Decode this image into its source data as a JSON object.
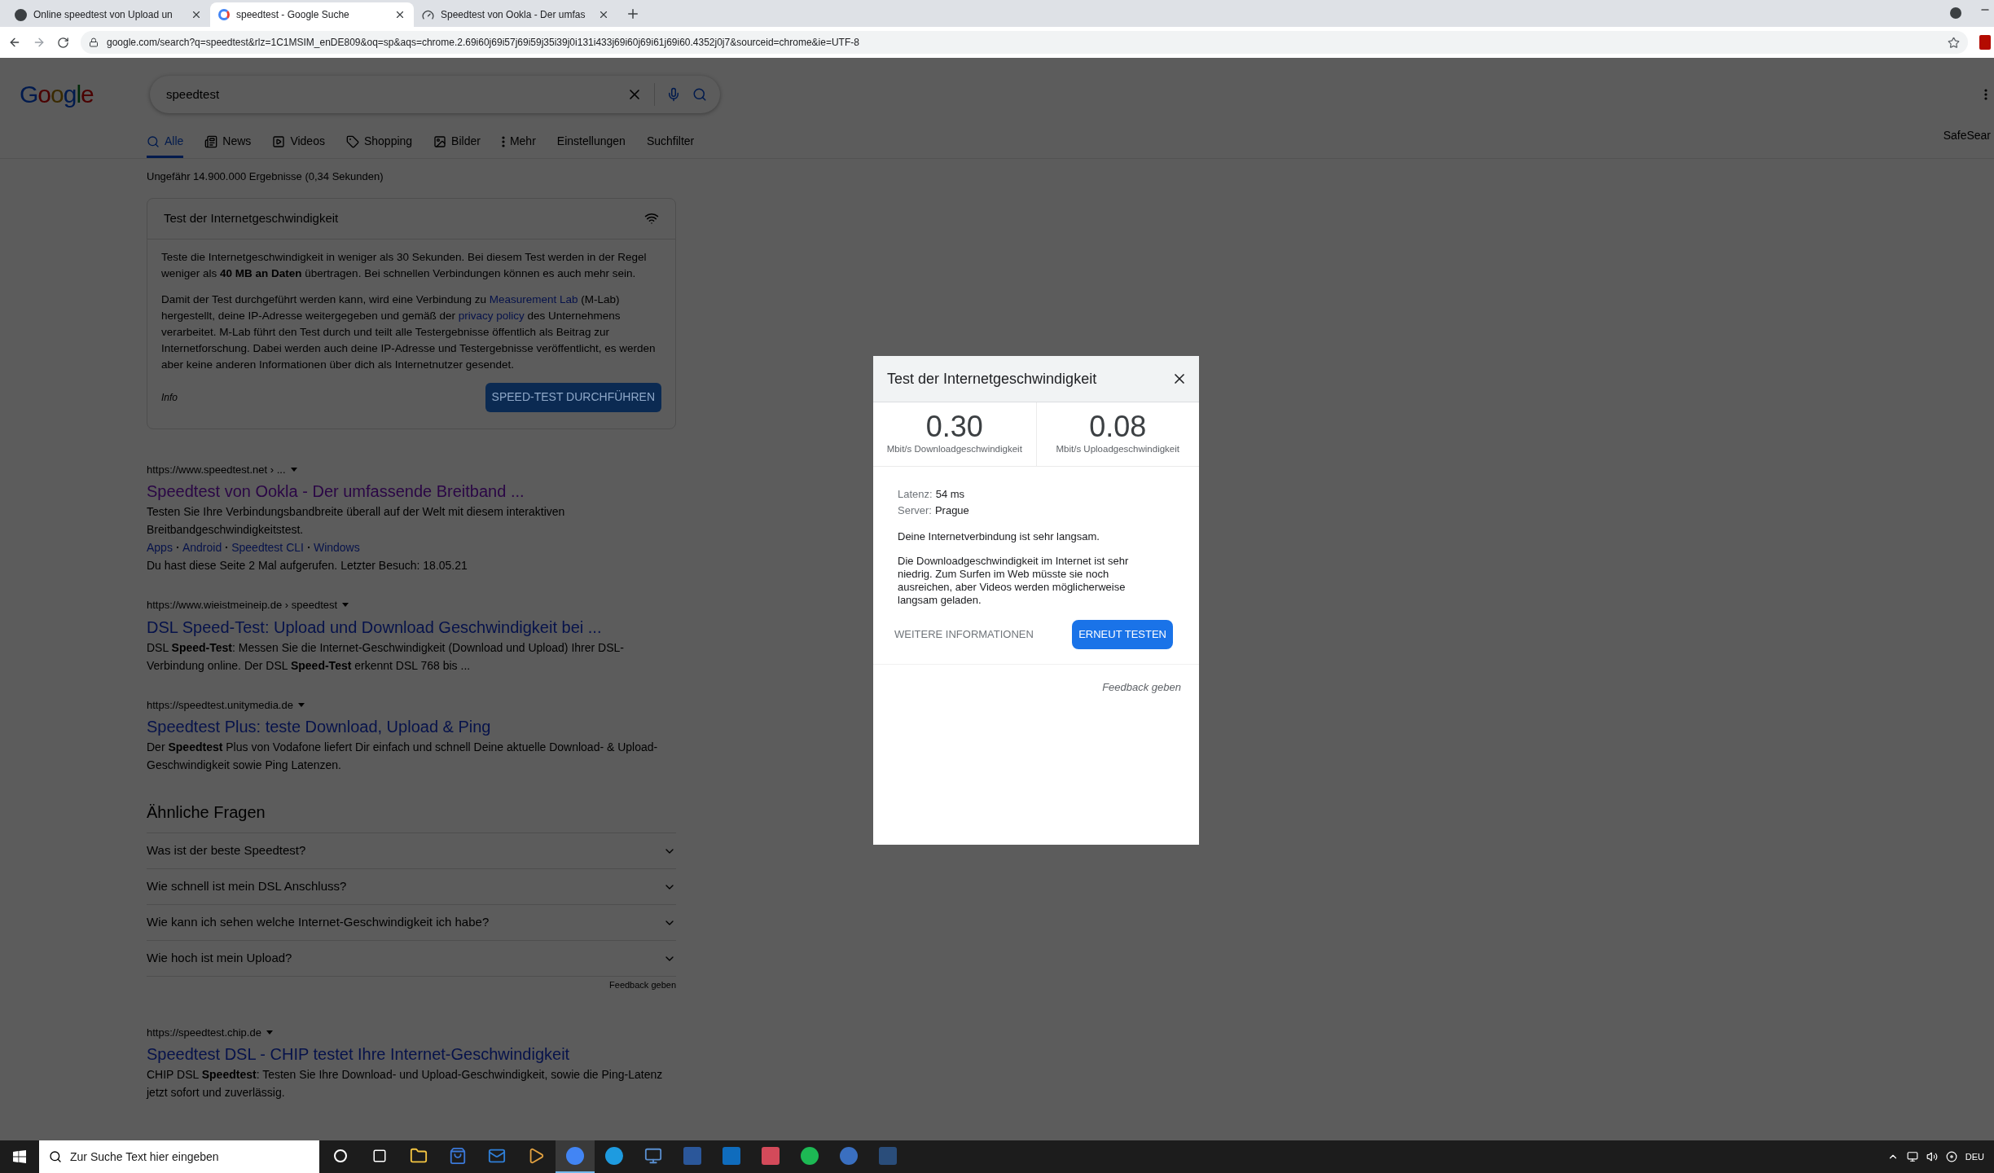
{
  "browser": {
    "tabs": [
      {
        "title": "Online speedtest von Upload un",
        "selected": false
      },
      {
        "title": "speedtest - Google Suche",
        "selected": true
      },
      {
        "title": "Speedtest von Ookla - Der umfas",
        "selected": false
      }
    ],
    "url": "google.com/search?q=speedtest&rlz=1C1MSIM_enDE809&oq=sp&aqs=chrome.2.69i60j69i57j69i59j35i39j0i131i433j69i60j69i61j69i60.4352j0j7&sourceid=chrome&ie=UTF-8"
  },
  "search": {
    "logo": "Google",
    "query": "speedtest",
    "nav_tabs": [
      {
        "label": "Alle",
        "selected": true
      },
      {
        "label": "News",
        "selected": false
      },
      {
        "label": "Videos",
        "selected": false
      },
      {
        "label": "Shopping",
        "selected": false
      },
      {
        "label": "Bilder",
        "selected": false
      },
      {
        "label": "Mehr",
        "selected": false
      },
      {
        "label": "Einstellungen",
        "selected": false
      },
      {
        "label": "Suchfilter",
        "selected": false
      }
    ],
    "safesearch": "SafeSear",
    "result_stats": "Ungefähr 14.900.000 Ergebnisse (0,34 Sekunden)",
    "speed_card": {
      "title": "Test der Internetgeschwindigkeit",
      "paragraphs": [
        [
          {
            "kind": "text",
            "text": "Teste die Internetgeschwindigkeit in weniger als 30 Sekunden. Bei diesem Test werden in der Regel weniger als **40 MB an Daten** übertragen. Bei schnellen Verbindungen können es auch mehr sein."
          }
        ],
        [
          {
            "kind": "text",
            "text": "Damit der Test durchgeführt werden kann, wird eine Verbindung zu"
          },
          {
            "kind": "link",
            "text": "Measurement Lab"
          },
          {
            "kind": "text",
            "text": "(M-Lab) hergestellt, deine IP-Adresse weitergegeben und gemäß der"
          },
          {
            "kind": "link",
            "text": "privacy policy"
          },
          {
            "kind": "text",
            "text": "des Unternehmens verarbeitet. M-Lab führt den Test durch und teilt alle Testergebnisse öffentlich als Beitrag zur Internetforschung. Dabei werden auch deine IP-Adresse und Testergebnisse veröffentlicht, es werden aber keine anderen Informationen über dich als Internetnutzer gesendet."
          }
        ]
      ],
      "info": "Info",
      "button": "SPEED-TEST DURCHFÜHREN"
    },
    "results_before": [
      {
        "url": "https://www.speedtest.net › ...",
        "title": "Speedtest von Ookla - Der umfassende Breitband ...",
        "visited": true,
        "snippet": "Testen Sie Ihre Verbindungsbandbreite überall auf der Welt mit diesem interaktiven Breitbandgeschwindigkeitstest.",
        "sitelinks": [
          "Apps",
          "Android",
          "Speedtest CLI",
          "Windows"
        ],
        "visit_note": "Du hast diese Seite 2 Mal aufgerufen. Letzter Besuch: 18.05.21"
      },
      {
        "url": "https://www.wieistmeineip.de › speedtest",
        "title": "DSL Speed-Test: Upload und Download Geschwindigkeit bei ...",
        "visited": false,
        "snippet": "DSL **Speed-Test**: Messen Sie die Internet-Geschwindigkeit (Download und Upload) Ihrer DSL-Verbindung online. Der DSL **Speed-Test** erkennt DSL 768 bis ..."
      },
      {
        "url": "https://speedtest.unitymedia.de",
        "title": "Speedtest Plus: teste Download, Upload & Ping",
        "visited": false,
        "snippet": "Der **Speedtest** Plus von Vodafone liefert Dir einfach und schnell Deine aktuelle Download- & Upload-Geschwindigkeit sowie Ping Latenzen."
      }
    ],
    "related": {
      "title": "Ähnliche Fragen",
      "items": [
        {
          "question": "Was ist der beste Speedtest?",
          "expanded": false
        },
        {
          "question": "Wie schnell ist mein DSL Anschluss?",
          "expanded": false
        },
        {
          "question": "Wie kann ich sehen welche Internet-Geschwindigkeit ich habe?",
          "expanded": false
        },
        {
          "question": "Wie hoch ist mein Upload?",
          "expanded": false
        }
      ],
      "feedback": "Feedback geben"
    },
    "results_after": [
      {
        "url": "https://speedtest.chip.de",
        "title": "Speedtest DSL - CHIP testet Ihre Internet-Geschwindigkeit",
        "visited": false,
        "snippet": "CHIP DSL **Speedtest**: Testen Sie Ihre Download- und Upload-Geschwindigkeit, sowie die Ping-Latenz jetzt sofort und zuverlässig."
      }
    ]
  },
  "dialog": {
    "title": "Test der Internetgeschwindigkeit",
    "metrics": [
      {
        "value": "0.30",
        "label": "Mbit/s Downloadgeschwindigkeit"
      },
      {
        "value": "0.08",
        "label": "Mbit/s Uploadgeschwindigkeit"
      }
    ],
    "details": [
      {
        "label": "Latenz:",
        "value": "54 ms"
      },
      {
        "label": "Server:",
        "value": "Prague"
      }
    ],
    "status": "Deine Internetverbindung ist sehr langsam.",
    "description": "Die Downloadgeschwindigkeit im Internet ist sehr niedrig. Zum Surfen im Web müsste sie noch ausreichen, aber Videos werden möglicherweise langsam geladen.",
    "more_button": "WEITERE INFORMATIONEN",
    "retest_button": "ERNEUT TESTEN",
    "feedback": "Feedback geben"
  },
  "taskbar": {
    "search_placeholder": "Zur Suche Text hier eingeben",
    "apps": [
      {
        "kind": "cortana",
        "active": false
      },
      {
        "kind": "taskview",
        "active": false
      },
      {
        "kind": "folder",
        "active": false
      },
      {
        "kind": "store",
        "active": false
      },
      {
        "kind": "mail",
        "active": false
      },
      {
        "kind": "media",
        "active": false
      },
      {
        "kind": "chrome",
        "active": true
      },
      {
        "kind": "edge",
        "active": false
      },
      {
        "kind": "monitor",
        "active": false
      },
      {
        "kind": "word",
        "active": false
      },
      {
        "kind": "outlook",
        "active": false
      },
      {
        "kind": "photos",
        "active": false
      },
      {
        "kind": "spotify",
        "active": false
      },
      {
        "kind": "disc",
        "active": false
      },
      {
        "kind": "steam",
        "active": false
      }
    ],
    "language": "DEU"
  }
}
